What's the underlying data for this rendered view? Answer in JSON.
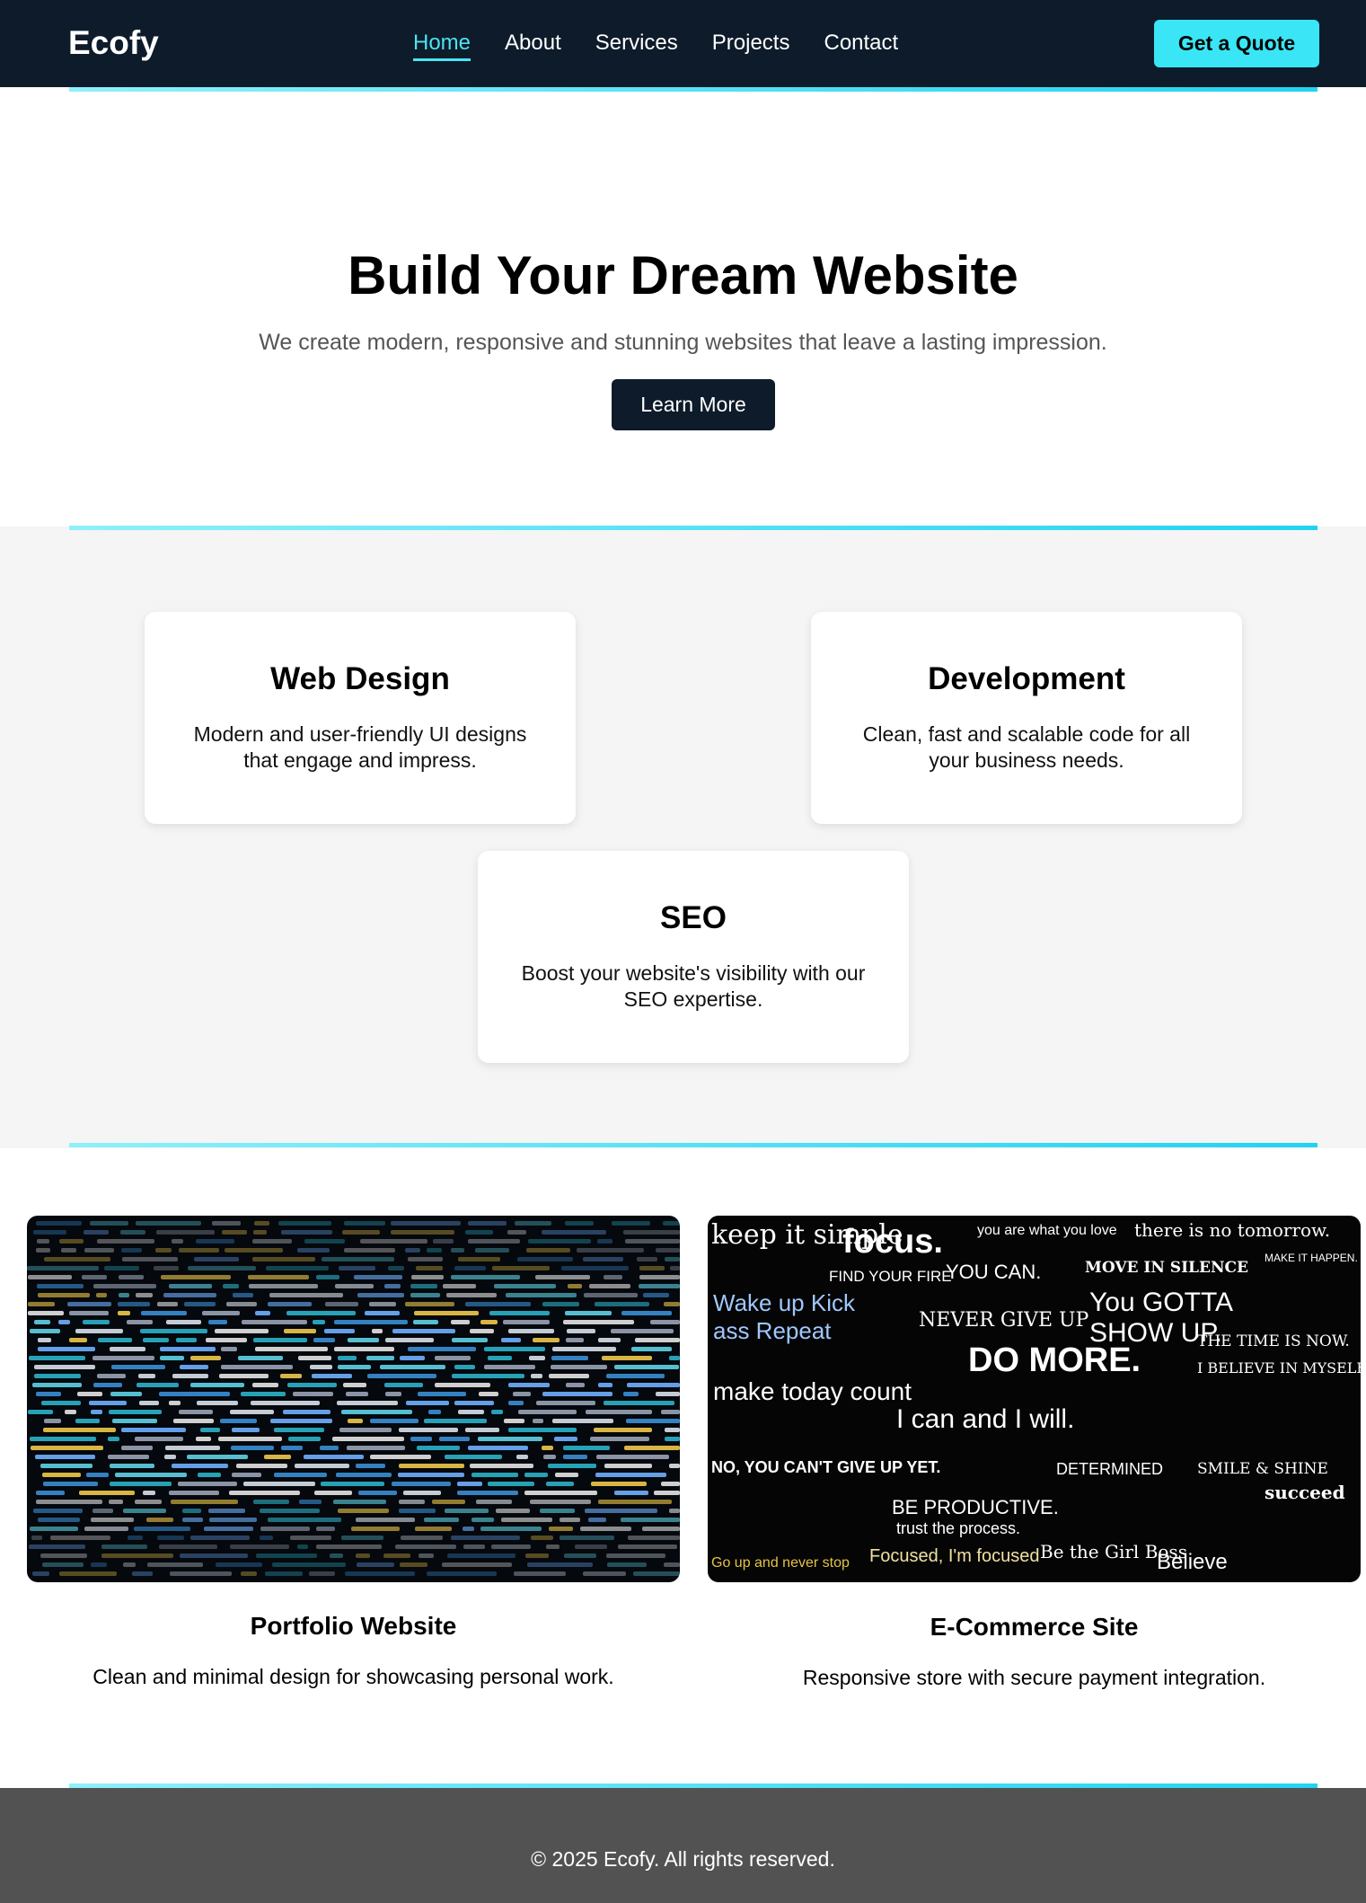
{
  "brand": {
    "name": "Ecofy"
  },
  "nav": {
    "links": [
      {
        "label": "Home",
        "active": true
      },
      {
        "label": "About",
        "active": false
      },
      {
        "label": "Services",
        "active": false
      },
      {
        "label": "Projects",
        "active": false
      },
      {
        "label": "Contact",
        "active": false
      }
    ],
    "cta_label": "Get a Quote"
  },
  "hero": {
    "title": "Build Your Dream Website",
    "subtitle": "We create modern, responsive and stunning websites that leave a lasting impression.",
    "button_label": "Learn More"
  },
  "services": [
    {
      "title": "Web Design",
      "description": "Modern and user-friendly UI designs that engage and impress."
    },
    {
      "title": "Development",
      "description": "Clean, fast and scalable code for all your business needs."
    },
    {
      "title": "SEO",
      "description": "Boost your website's visibility with our SEO expertise."
    }
  ],
  "projects": [
    {
      "title": "Portfolio Website",
      "description": "Clean and minimal design for showcasing personal work."
    },
    {
      "title": "E-Commerce Site",
      "description": "Responsive store with secure payment integration."
    }
  ],
  "project_images": {
    "moodboard_words": [
      "keep it simple",
      "focus.",
      "you are what you love",
      "there is no tomorrow.",
      "FIND YOUR FIRE",
      "YOU CAN.",
      "MOVE IN SILENCE",
      "MAKE IT HAPPEN. SHOCK EVERYONE.",
      "Wake up Kick ass Repeat",
      "NEVER GIVE UP",
      "You GOTTA SHOW UP.",
      "DO MORE.",
      "THE TIME IS NOW.",
      "make today count",
      "I can and I will.",
      "I BELIEVE IN MYSELF",
      "NO, YOU CAN'T GIVE UP YET.",
      "DETERMINED",
      "SMILE & SHINE",
      "BE PRODUCTIVE.",
      "trust the process.",
      "succeed",
      "Go up and never stop",
      "Focused, I'm focused",
      "Be the Girl Boss",
      "Believe"
    ]
  },
  "footer": {
    "text": "© 2025 Ecofy. All rights reserved."
  },
  "colors": {
    "navy": "#0d1b2a",
    "accent": "#3ae6f5",
    "footer": "#525252",
    "section_bg": "#f5f5f5"
  }
}
